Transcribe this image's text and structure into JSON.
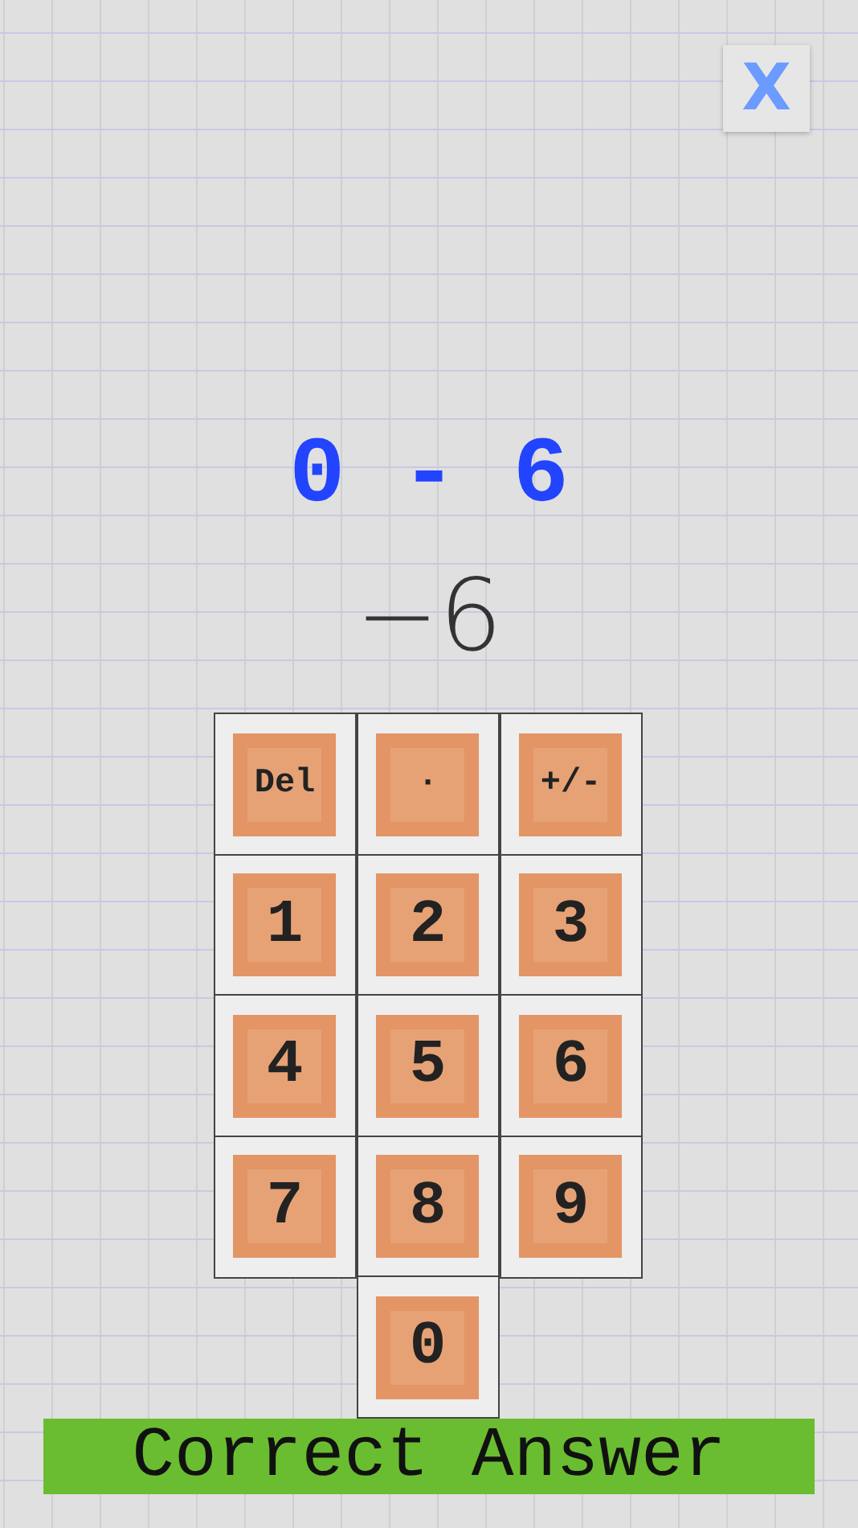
{
  "close_button": {
    "label": "X"
  },
  "equation": "0 - 6",
  "answer": "−6",
  "keypad": [
    {
      "label": "Del",
      "kind": "function"
    },
    {
      "label": "·",
      "kind": "function"
    },
    {
      "label": "+/-",
      "kind": "function"
    },
    {
      "label": "1",
      "kind": "digit"
    },
    {
      "label": "2",
      "kind": "digit"
    },
    {
      "label": "3",
      "kind": "digit"
    },
    {
      "label": "4",
      "kind": "digit"
    },
    {
      "label": "5",
      "kind": "digit"
    },
    {
      "label": "6",
      "kind": "digit"
    },
    {
      "label": "7",
      "kind": "digit"
    },
    {
      "label": "8",
      "kind": "digit"
    },
    {
      "label": "9",
      "kind": "digit"
    },
    {
      "label": "0",
      "kind": "digit"
    }
  ],
  "feedback": {
    "text": "Correct Answer",
    "kind": "correct"
  }
}
